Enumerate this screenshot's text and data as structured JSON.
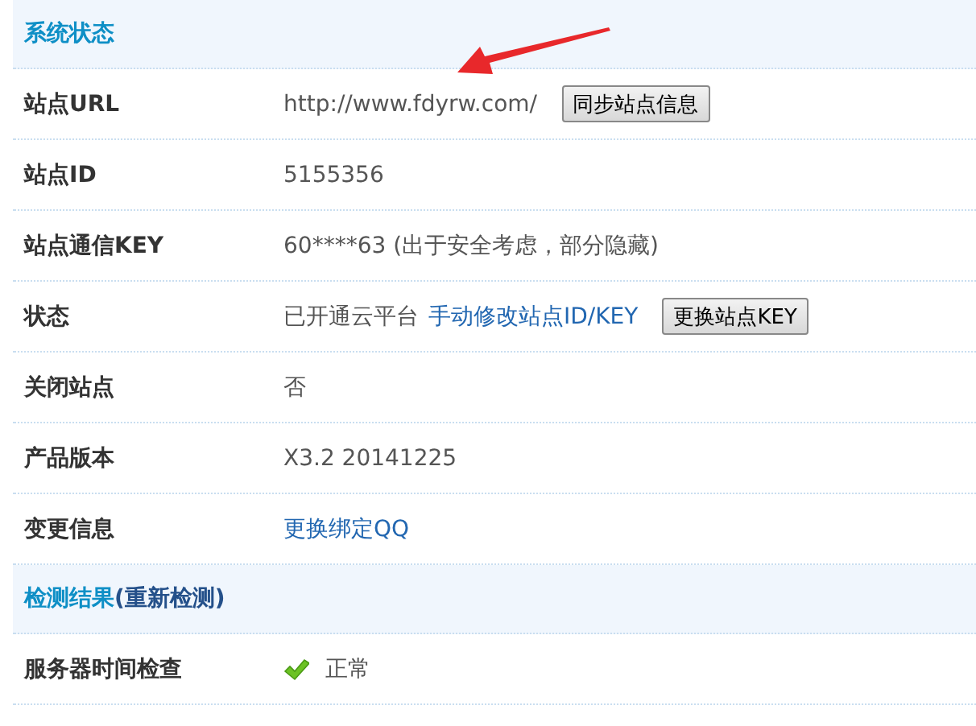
{
  "sections": [
    {
      "title": "系统状态",
      "rows": [
        {
          "label": "站点URL",
          "items": [
            {
              "kind": "text",
              "text": "http://www.fdyrw.com/"
            },
            {
              "kind": "button",
              "text": "同步站点信息"
            }
          ]
        },
        {
          "label": "站点ID",
          "items": [
            {
              "kind": "text",
              "text": "5155356"
            }
          ]
        },
        {
          "label": "站点通信KEY",
          "items": [
            {
              "kind": "text",
              "text": "60****63 (出于安全考虑，部分隐藏)"
            }
          ]
        },
        {
          "label": "状态",
          "items": [
            {
              "kind": "text",
              "text": "已开通云平台"
            },
            {
              "kind": "link",
              "text": "手动修改站点ID/KEY"
            },
            {
              "kind": "button",
              "text": "更换站点KEY"
            }
          ]
        },
        {
          "label": "关闭站点",
          "items": [
            {
              "kind": "text",
              "text": "否"
            }
          ]
        },
        {
          "label": "产品版本",
          "items": [
            {
              "kind": "text",
              "text": "X3.2 20141225"
            }
          ]
        },
        {
          "label": "变更信息",
          "items": [
            {
              "kind": "link",
              "text": "更换绑定QQ"
            }
          ]
        }
      ]
    },
    {
      "title": "检测结果",
      "link": "(重新检测)",
      "rows": [
        {
          "label": "服务器时间检查",
          "items": [
            {
              "kind": "ok",
              "text": "正常"
            }
          ]
        }
      ]
    }
  ]
}
